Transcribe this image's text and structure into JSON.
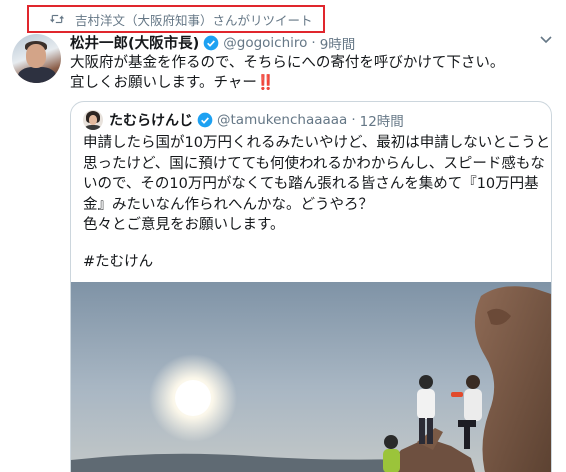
{
  "retweet": {
    "text": "吉村洋文（大阪府知事）さんがリツイート",
    "highlight_color": "#e0262d"
  },
  "tweet": {
    "author": {
      "name": "松井一郎(大阪市長)",
      "handle": "@gogoichiro",
      "verified": true
    },
    "separator": "·",
    "time": "9時間",
    "lines": [
      "大阪府が基金を作るので、そちらにへの寄付を呼びかけて下さい。",
      "宜しくお願いします。チャー"
    ],
    "emoji": "‼️"
  },
  "quoted_tweet": {
    "author": {
      "name": "たむらけんじ",
      "handle": "@tamukenchaaaaa",
      "verified": true
    },
    "separator": "·",
    "time": "12時間",
    "lines": [
      "申請したら国が10万円くれるみたいやけど、最初は申請しないとこうと",
      "思ったけど、国に預けてても何使われるかわからんし、スピード感もな",
      "いので、その10万円がなくても踏ん張れる皆さんを集めて『10万円基",
      "金』みたいなん作られへんかな。どうやろ？",
      "色々とご意見をお願いします。"
    ],
    "hashtag": "#たむけん"
  },
  "colors": {
    "text": "#14171a",
    "secondary": "#657786",
    "verified_blue": "#1da1f2",
    "border": "#ccd6dd"
  },
  "icons": {
    "retweet": "retweet-icon",
    "verified": "verified-badge-icon",
    "caret": "chevron-down-icon"
  }
}
